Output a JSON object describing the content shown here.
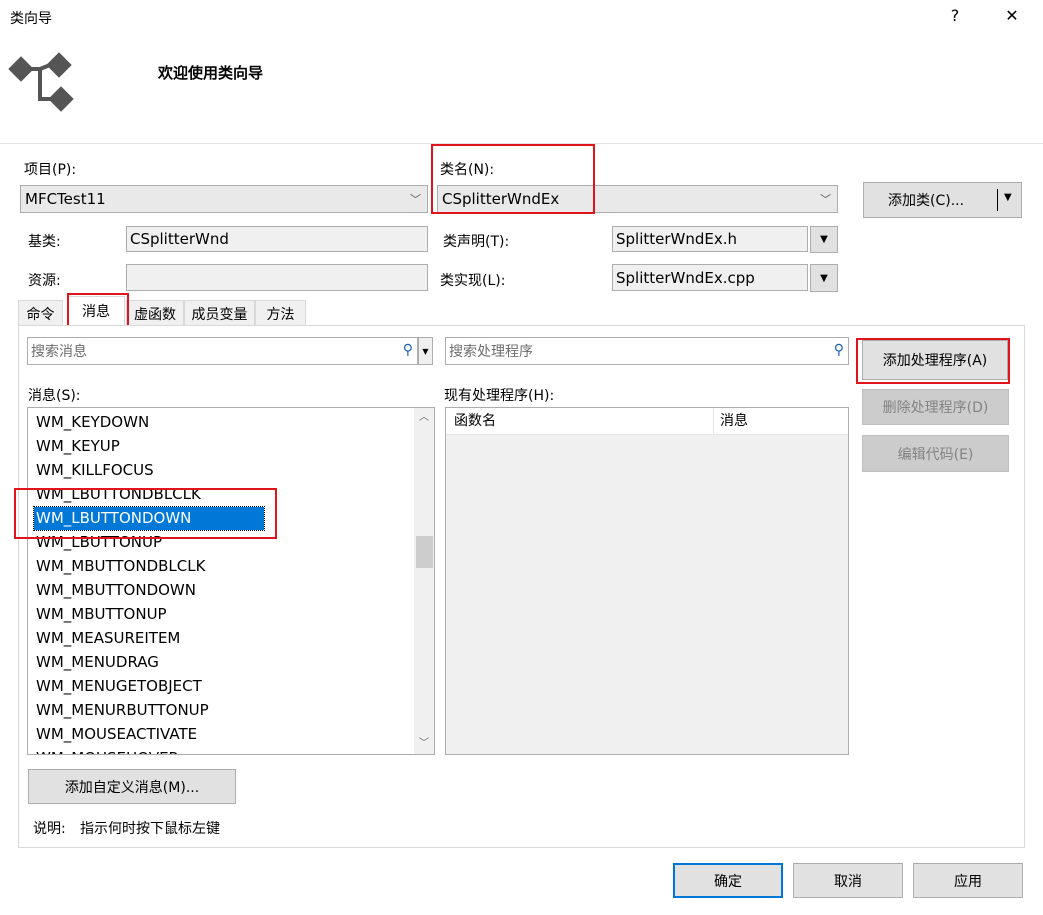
{
  "window": {
    "title": "类向导",
    "help_glyph": "?",
    "close_glyph": "✕"
  },
  "header": {
    "title": "欢迎使用类向导"
  },
  "project": {
    "label": "项目(P):",
    "value": "MFCTest11"
  },
  "classname": {
    "label": "类名(N):",
    "value": "CSplitterWndEx"
  },
  "add_class": {
    "label": "添加类(C)...",
    "arrow": "▼"
  },
  "base_class": {
    "label": "基类:",
    "value": "CSplitterWnd"
  },
  "resource": {
    "label": "资源:",
    "value": ""
  },
  "class_decl": {
    "label": "类声明(T):",
    "value": "SplitterWndEx.h"
  },
  "class_impl": {
    "label": "类实现(L):",
    "value": "SplitterWndEx.cpp"
  },
  "tabs": [
    {
      "label": "命令"
    },
    {
      "label": "消息"
    },
    {
      "label": "虚函数"
    },
    {
      "label": "成员变量"
    },
    {
      "label": "方法"
    }
  ],
  "search_messages": {
    "placeholder": "搜索消息"
  },
  "search_handlers": {
    "placeholder": "搜索处理程序"
  },
  "messages": {
    "label": "消息(S):",
    "items": [
      "WM_KEYDOWN",
      "WM_KEYUP",
      "WM_KILLFOCUS",
      "WM_LBUTTONDBLCLK",
      "WM_LBUTTONDOWN",
      "WM_LBUTTONUP",
      "WM_MBUTTONDBLCLK",
      "WM_MBUTTONDOWN",
      "WM_MBUTTONUP",
      "WM_MEASUREITEM",
      "WM_MENUDRAG",
      "WM_MENUGETOBJECT",
      "WM_MENURBUTTONUP",
      "WM_MOUSEACTIVATE",
      "WM_MOUSEHOVER"
    ],
    "selected": "WM_LBUTTONDOWN"
  },
  "handlers": {
    "label": "现有处理程序(H):",
    "col_function": "函数名",
    "col_message": "消息"
  },
  "buttons": {
    "add_handler": "添加处理程序(A)",
    "delete_handler": "删除处理程序(D)",
    "edit_code": "编辑代码(E)",
    "add_custom_message": "添加自定义消息(M)...",
    "ok": "确定",
    "cancel": "取消",
    "apply": "应用"
  },
  "description": {
    "label": "说明:",
    "text": "指示何时按下鼠标左键"
  },
  "colors": {
    "selection": "#0078d7",
    "highlight_box": "#e1141b",
    "dialog_bg": "#ffffff"
  },
  "icons": {
    "wizard": "class-wizard-icon",
    "search": "search-icon",
    "dropdown": "chevron-down-icon"
  }
}
